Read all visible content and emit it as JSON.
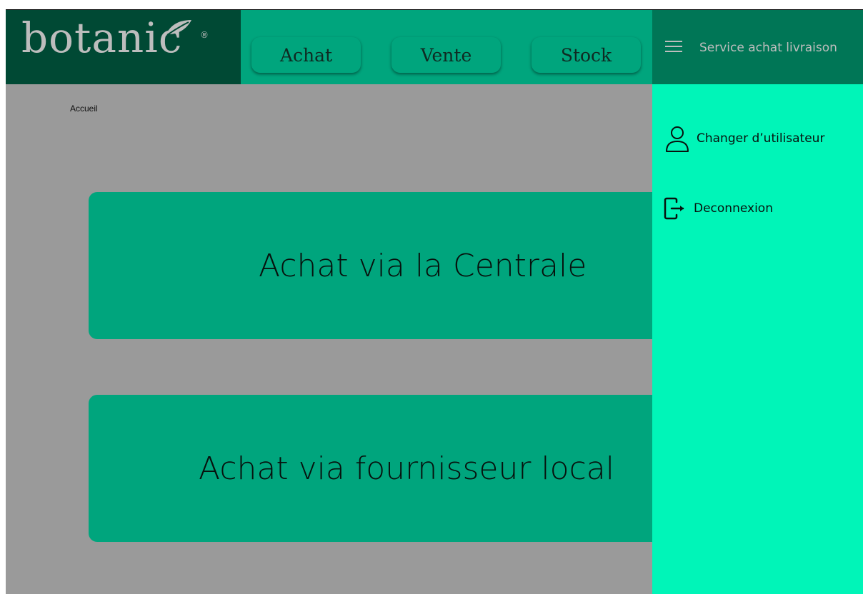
{
  "header": {
    "logo_text": "botanic",
    "logo_registered": "®",
    "nav": [
      {
        "label": "Achat"
      },
      {
        "label": "Vente"
      },
      {
        "label": "Stock"
      }
    ],
    "right_title": "Service achat livraison"
  },
  "breadcrumb": "Accueil",
  "cards": [
    {
      "label": "Achat via la Centrale"
    },
    {
      "label": "Achat via fournisseur local"
    }
  ],
  "drawer": {
    "items": [
      {
        "label": "Changer d’utilisateur",
        "icon": "user-icon"
      },
      {
        "label": "Deconnexion",
        "icon": "logout-icon"
      }
    ]
  },
  "colors": {
    "overlay": "#9a9a9a",
    "header": "#00a57d",
    "logo_bg": "#004934",
    "drawer_header": "#007656",
    "drawer_bg": "#00f5b8"
  }
}
